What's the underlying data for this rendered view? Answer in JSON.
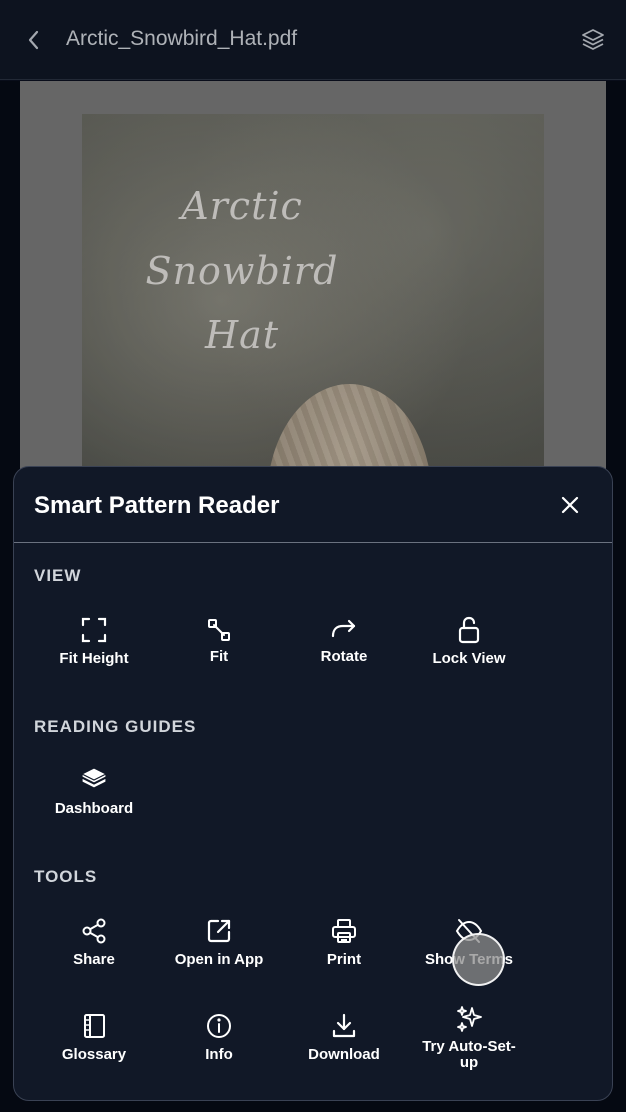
{
  "header": {
    "title": "Arctic_Snowbird_Hat.pdf",
    "back_icon": "chevron-left-icon",
    "layers_icon": "layers-icon"
  },
  "document": {
    "cover_title_line1": "Arctic Snowbird",
    "cover_title_line2": "Hat"
  },
  "sheet": {
    "title": "Smart Pattern Reader",
    "close_icon": "close-icon",
    "sections": {
      "view": {
        "label": "VIEW",
        "items": [
          {
            "label": "Fit Height",
            "icon": "fit-height-icon"
          },
          {
            "label": "Fit",
            "icon": "fit-icon"
          },
          {
            "label": "Rotate",
            "icon": "rotate-icon"
          },
          {
            "label": "Lock View",
            "icon": "unlock-icon"
          }
        ]
      },
      "reading_guides": {
        "label": "READING GUIDES",
        "items": [
          {
            "label": "Dashboard",
            "icon": "stack-icon"
          }
        ]
      },
      "tools": {
        "label": "TOOLS",
        "items": [
          {
            "label": "Share",
            "icon": "share-icon"
          },
          {
            "label": "Open in App",
            "icon": "external-link-icon"
          },
          {
            "label": "Print",
            "icon": "printer-icon"
          },
          {
            "label": "Show Terms",
            "icon": "eye-off-icon"
          },
          {
            "label": "Glossary",
            "icon": "book-icon"
          },
          {
            "label": "Info",
            "icon": "info-icon"
          },
          {
            "label": "Download",
            "icon": "download-icon"
          },
          {
            "label": "Try Auto-Set-up",
            "icon": "sparkles-icon"
          }
        ]
      }
    }
  },
  "colors": {
    "sheet_bg": "#111827",
    "topbar_bg": "#111827",
    "text": "#ffffff",
    "section_label": "#d1d5db"
  }
}
